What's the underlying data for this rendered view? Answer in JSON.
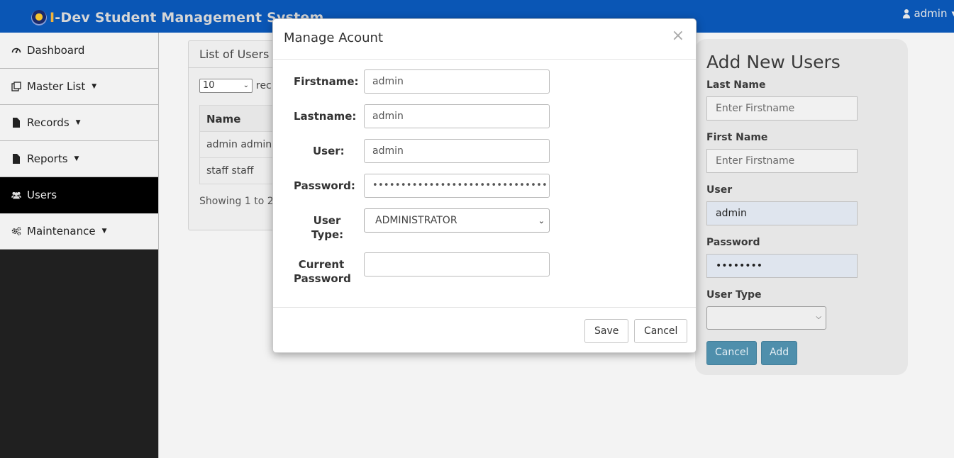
{
  "header": {
    "brand_first_letter": "I",
    "brand_rest": "-Dev Student Management System",
    "user_label": "admin",
    "user_caret": "▾"
  },
  "sidebar": {
    "items": [
      {
        "label": "Dashboard",
        "icon": "dashboard-icon",
        "has_caret": false
      },
      {
        "label": "Master List",
        "icon": "list-icon",
        "has_caret": true
      },
      {
        "label": "Records",
        "icon": "file-icon",
        "has_caret": true
      },
      {
        "label": "Reports",
        "icon": "file-icon",
        "has_caret": true
      },
      {
        "label": "Users",
        "icon": "users-icon",
        "has_caret": false,
        "active": true
      },
      {
        "label": "Maintenance",
        "icon": "cogs-icon",
        "has_caret": true
      }
    ]
  },
  "list_panel": {
    "title": "List of Users",
    "page_length": "10",
    "records_label": "rec",
    "column_name": "Name",
    "rows": [
      "admin admin",
      "staff staff"
    ],
    "showing": "Showing 1 to 2"
  },
  "add_panel": {
    "title": "Add New Users",
    "last_name_label": "Last Name",
    "last_name_placeholder": "Enter Firstname",
    "first_name_label": "First Name",
    "first_name_placeholder": "Enter Firstname",
    "user_label": "User",
    "user_value": "admin",
    "password_label": "Password",
    "password_value": "••••••••",
    "user_type_label": "User Type",
    "cancel_label": "Cancel",
    "add_label": "Add"
  },
  "modal": {
    "title": "Manage Acount",
    "close_glyph": "×",
    "firstname_label": "Firstname:",
    "firstname_value": "admin",
    "lastname_label": "Lastname:",
    "lastname_value": "admin",
    "user_label": "User:",
    "user_value": "admin",
    "password_label": "Password:",
    "password_value": "••••••••••••••••••••••••••••••••",
    "user_type_label_1": "User",
    "user_type_label_2": "Type:",
    "user_type_value": "ADMINISTRATOR",
    "current_password_label_1": "Current",
    "current_password_label_2": "Password",
    "current_password_value": "",
    "save_label": "Save",
    "cancel_label": "Cancel"
  }
}
